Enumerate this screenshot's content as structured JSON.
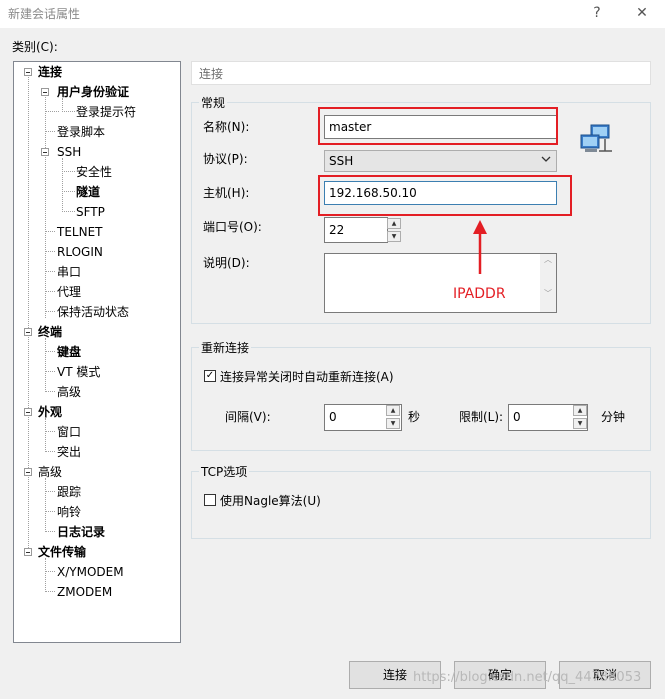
{
  "window": {
    "title": "新建会话属性",
    "help_glyph": "?",
    "close_glyph": "✕"
  },
  "sidebar": {
    "label": "类别(C):",
    "items": [
      {
        "label": "连接"
      },
      {
        "label": "用户身份验证"
      },
      {
        "label": "登录提示符"
      },
      {
        "label": "登录脚本"
      },
      {
        "label": "SSH"
      },
      {
        "label": "安全性"
      },
      {
        "label": "隧道"
      },
      {
        "label": "SFTP"
      },
      {
        "label": "TELNET"
      },
      {
        "label": "RLOGIN"
      },
      {
        "label": "串口"
      },
      {
        "label": "代理"
      },
      {
        "label": "保持活动状态"
      },
      {
        "label": "终端"
      },
      {
        "label": "键盘"
      },
      {
        "label": "VT 模式"
      },
      {
        "label": "高级"
      },
      {
        "label": "外观"
      },
      {
        "label": "窗口"
      },
      {
        "label": "突出"
      },
      {
        "label": "高级"
      },
      {
        "label": "跟踪"
      },
      {
        "label": "响铃"
      },
      {
        "label": "日志记录"
      },
      {
        "label": "文件传输"
      },
      {
        "label": "X/YMODEM"
      },
      {
        "label": "ZMODEM"
      }
    ]
  },
  "main": {
    "header": "连接",
    "general": {
      "title": "常规",
      "name_label": "名称(N):",
      "name_value": "master",
      "protocol_label": "协议(P):",
      "protocol_value": "SSH",
      "host_label": "主机(H):",
      "host_value": "192.168.50.10",
      "port_label": "端口号(O):",
      "port_value": "22",
      "desc_label": "说明(D):",
      "desc_value": ""
    },
    "annotation": {
      "text": "IPADDR",
      "color": "#e31e24"
    },
    "reconnect": {
      "title": "重新连接",
      "checkbox_label": "连接异常关闭时自动重新连接(A)",
      "checked": true,
      "interval_label": "间隔(V):",
      "interval_value": "0",
      "interval_unit": "秒",
      "limit_label": "限制(L):",
      "limit_value": "0",
      "limit_unit": "分钟"
    },
    "tcp": {
      "title": "TCP选项",
      "nagle_label": "使用Nagle算法(U)",
      "checked": false
    }
  },
  "buttons": {
    "connect": "连接",
    "ok": "确定",
    "cancel": "取消"
  },
  "watermark": "https://blog.csdn.net/qq_44788053"
}
